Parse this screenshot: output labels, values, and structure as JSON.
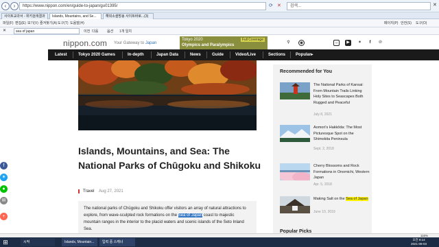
{
  "browser": {
    "url": "https://www.nippon.com/en/guide-to-japan/gu01395/",
    "search_placeholder": "검색...",
    "tabs": [
      "사이트교과서 - 위키검색결과",
      "Islands, Mountains, and Se...",
      "해외소셜방송 사이트바로...(3)"
    ],
    "menu": [
      "파일(F)",
      "편집(E)",
      "보기(V)",
      "즐겨찾기(A)",
      "도구(T)",
      "도움말(H)"
    ],
    "find_value": "sea of japan",
    "find_labels": [
      "이전",
      "다음",
      "옵션",
      "1개 일치"
    ],
    "right_tools": [
      "페이지(P)",
      "안전(S)",
      "도구(O)"
    ],
    "zoom": "115%"
  },
  "site": {
    "logo": "nippon",
    "logo_dot": ".",
    "logo_tld": "com",
    "tagline_prefix": "Your Gateway to",
    "tagline_jp": "Japan",
    "banner": {
      "line1": "Tokyo 2020",
      "line2": "Olympics and Paralympics",
      "tag": "Full Coverage"
    },
    "social_icons": [
      "search-icon",
      "globe-icon",
      "instagram-icon",
      "youtube-icon",
      "twitter-icon",
      "facebook-icon",
      "rss-icon"
    ],
    "nav": [
      "Latest",
      "Tokyo 2020 Games",
      "In-depth",
      "Japan Data",
      "News",
      "Guide",
      "Video/Live",
      "Sections",
      "Popular▸"
    ]
  },
  "article": {
    "title": "Islands, Mountains, and Sea: The National Parks of Chūgoku and Shikoku",
    "category": "Travel",
    "date": "Aug 27, 2021",
    "lead_before": "The national parks of Chūgoku and Shikoku offer visitors an array of natural attractions to explore, from wave-sculpted rock formations on the ",
    "lead_highlight": "Sea of Japan",
    "lead_after": " coast to majestic mountain ranges in the interior to the placid waters and scenic islands of the Seto Inland Sea."
  },
  "sidebar": {
    "title": "Recommended for You",
    "items": [
      {
        "title": "The National Parks of Kansai: From Mountain Trails Linking Holy Sites to Seascapes Both Rugged and Peaceful",
        "date": "July 8, 2021"
      },
      {
        "title": "Aomori's Hakkōda: The Most Picturesque Spot on the Shimokita Peninsula",
        "date": "Sept. 2, 2018"
      },
      {
        "title": "Cherry Blossoms and Rock Formations in Onomichi, Western Japan",
        "date": "Apr. 5, 2018"
      },
      {
        "title_before": "Making Salt on the ",
        "title_highlight": "Sea of Japan",
        "date": "June 10, 2019"
      }
    ],
    "popular_title": "Popular Picks"
  },
  "share": [
    {
      "icon": "facebook-icon",
      "color": "#3b5998"
    },
    {
      "icon": "twitter-icon",
      "color": "#1da1f2"
    },
    {
      "icon": "line-icon",
      "color": "#00c300"
    },
    {
      "icon": "email-icon",
      "color": "#888888"
    },
    {
      "icon": "plus-icon",
      "color": "#ff6550"
    }
  ],
  "taskbar": {
    "start_label": "시작",
    "tasks": [
      "Islands, Mountain...",
      "입력 중 스캐너"
    ],
    "clock_time": "오전 9:14",
    "clock_date": "2021-09-03"
  }
}
